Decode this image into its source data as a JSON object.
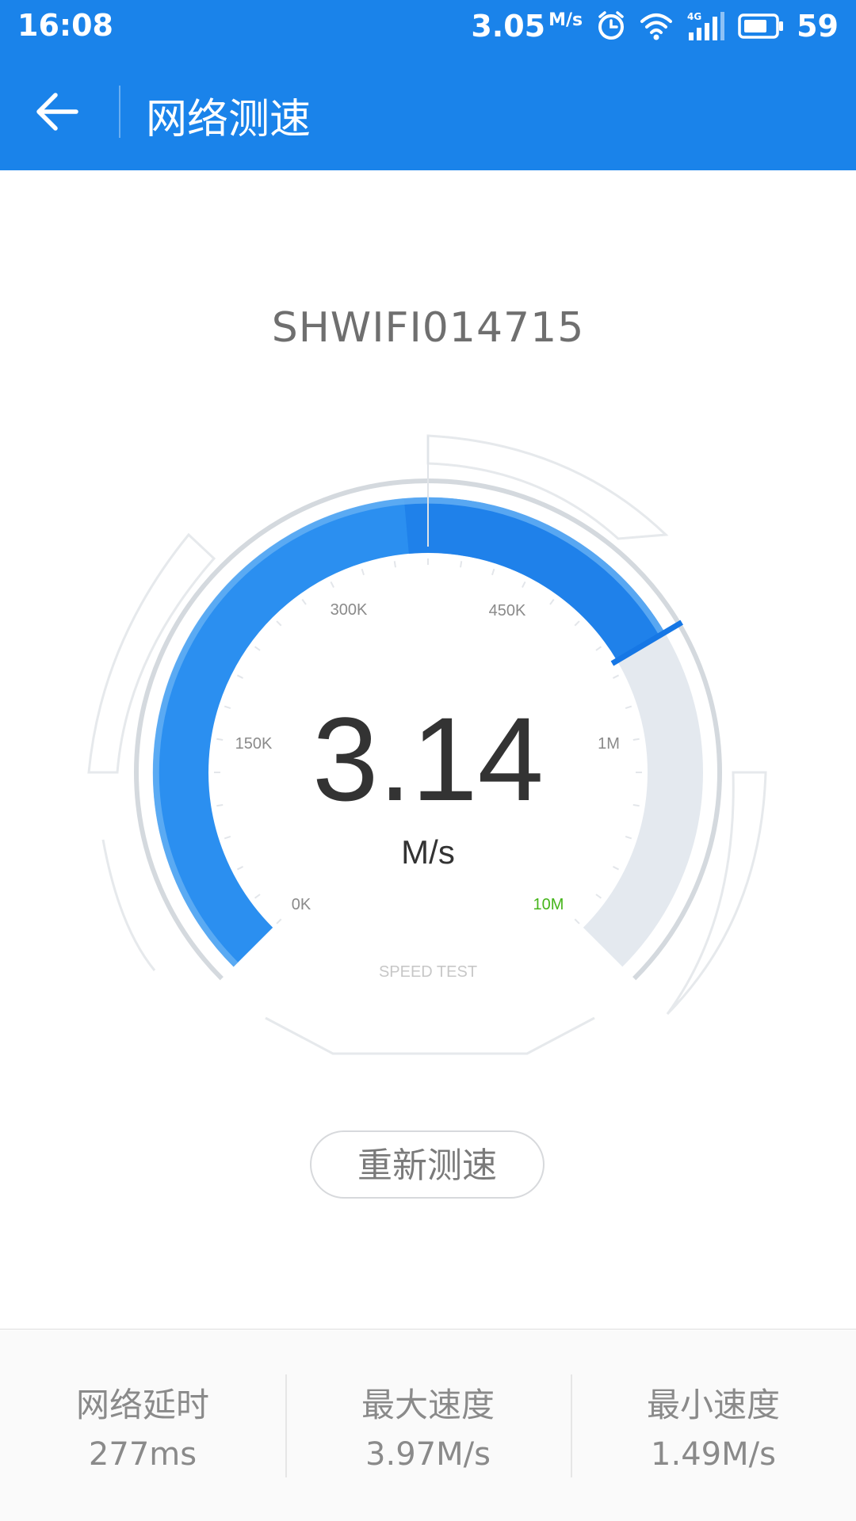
{
  "status_bar": {
    "time": "16:08",
    "net_speed": "3.05",
    "net_speed_unit": "M/s",
    "network_type": "4G",
    "battery": "59",
    "icons": [
      "alarm-icon",
      "wifi-icon",
      "cell-signal-icon",
      "battery-icon"
    ]
  },
  "toolbar": {
    "title": "网络测速",
    "back_icon": "back-arrow-icon"
  },
  "network_name": "SHWIFI014715",
  "gauge": {
    "speed_value": "3.14",
    "speed_unit": "M/s",
    "scale_labels": [
      "0K",
      "150K",
      "300K",
      "450K",
      "1M",
      "10M"
    ],
    "caption": "SPEED TEST",
    "fill_fraction": 0.72,
    "colors": {
      "fill": "#2b8ff0",
      "fill_dark": "#1677e5",
      "track": "#e4e9ef",
      "highlight": "#66b0f4",
      "ring": "#d4d9de",
      "max_label": "#46b51b"
    }
  },
  "retest_button": "重新测速",
  "stats": [
    {
      "label": "网络延时",
      "value": "277ms"
    },
    {
      "label": "最大速度",
      "value": "3.97M/s"
    },
    {
      "label": "最小速度",
      "value": "1.49M/s"
    }
  ],
  "colors": {
    "header_bg": "#1a83ea",
    "page_bg": "#ffffff"
  }
}
